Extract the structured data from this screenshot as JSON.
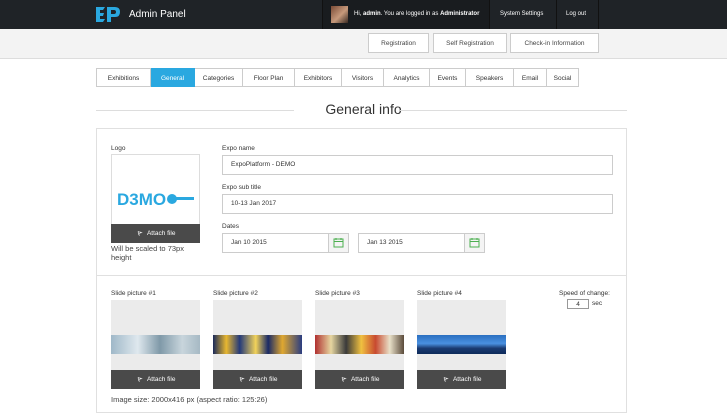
{
  "header": {
    "brand": "Admin Panel",
    "greeting_prefix": "Hi, ",
    "user": "admin",
    "greeting_mid": ". You are logged in as ",
    "role": "Administrator",
    "system_settings": "System Settings",
    "logout": "Log out"
  },
  "subnav": {
    "registration": "Registration",
    "self_registration": "Self Registration",
    "checkin": "Check-in Information"
  },
  "tabs": [
    "Exhibitions",
    "General",
    "Categories",
    "Floor Plan",
    "Exhibitors",
    "Visitors",
    "Analytics",
    "Events",
    "Speakers",
    "Email",
    "Social"
  ],
  "active_tab": "General",
  "section_title": "General info",
  "logo": {
    "label": "Logo",
    "attach": "Attach file",
    "note": "Will be scaled to 73px height",
    "demo_text": "D3MO"
  },
  "expo_name": {
    "label": "Expo name",
    "value": "ExpoPlatform - DEMO"
  },
  "expo_subtitle": {
    "label": "Expo sub title",
    "value": "10-13 Jan 2017"
  },
  "dates": {
    "label": "Dates",
    "start": "Jan 10 2015",
    "end": "Jan 13 2015"
  },
  "slides": [
    {
      "label": "Slide picture #1",
      "attach": "Attach file"
    },
    {
      "label": "Slide picture #2",
      "attach": "Attach file"
    },
    {
      "label": "Slide picture #3",
      "attach": "Attach file"
    },
    {
      "label": "Slide picture #4",
      "attach": "Attach file"
    }
  ],
  "speed": {
    "label": "Speed of change:",
    "value": "4",
    "unit": "sec"
  },
  "image_size_note": "Image size: 2000x416 px (aspect ratio: 125:26)",
  "colors": {
    "accent": "#2aa8e0",
    "topbar": "#1f2327",
    "attach_bg": "#4a4a4a"
  },
  "icons": {
    "calendar": "calendar-icon",
    "paperclip": "paperclip-icon"
  }
}
